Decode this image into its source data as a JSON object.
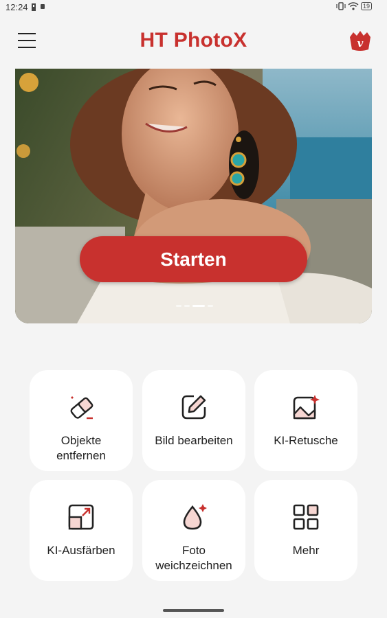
{
  "status_bar": {
    "time": "12:24",
    "battery": "19"
  },
  "app": {
    "title": "HT PhotoX",
    "brand_color": "#c8312e",
    "vip_letter": "v"
  },
  "banner": {
    "start_label": "Starten",
    "slide_count": 4,
    "active_slide": 3
  },
  "tools": [
    {
      "label": "Objekte\nentfernen",
      "icon": "eraser-icon"
    },
    {
      "label": "Bild bearbeiten",
      "icon": "edit-icon"
    },
    {
      "label": "KI-Retusche",
      "icon": "retouch-icon"
    },
    {
      "label": "KI-Ausfärben",
      "icon": "colorize-icon"
    },
    {
      "label": "Foto\nweichzeichnen",
      "icon": "blur-drop-icon"
    },
    {
      "label": "Mehr",
      "icon": "more-grid-icon"
    }
  ]
}
